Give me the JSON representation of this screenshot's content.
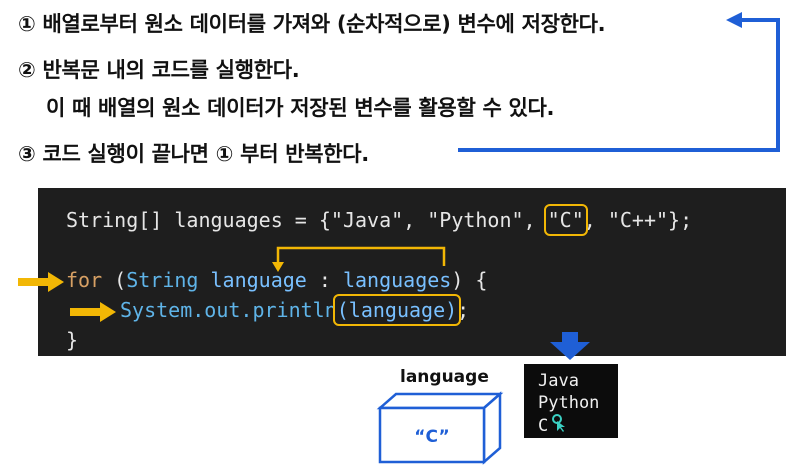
{
  "steps": {
    "s1": "① 배열로부터 원소 데이터를 가져와 (순차적으로) 변수에 저장한다.",
    "s2": "② 반복문 내의 코드를 실행한다.",
    "s2b": "이 때 배열의 원소 데이터가 저장된 변수를 활용할 수 있다.",
    "s3": "③ 코드 실행이 끝나면 ① 부터 반복한다."
  },
  "code": {
    "l1_a": "String[] languages = {\"Java\", \"Python\", ",
    "l1_box": "\"C\"",
    "l1_b": ", \"C++\"};",
    "l2_for": "for",
    "l2_open": " (",
    "l2_type": "String",
    "l2_sp": " ",
    "l2_var": "language",
    "l2_colon": " : ",
    "l2_arr": "languages",
    "l2_close": ") {",
    "l3_fn": "System.out.println",
    "l3_arg": "(language)",
    "l3_end": ";",
    "l4": "}"
  },
  "variable_box": {
    "label": "language",
    "value": "“C”"
  },
  "console": {
    "lines": [
      "Java",
      "Python",
      "C"
    ]
  },
  "colors": {
    "accent_arrow": "#f2b705",
    "loop_arrow": "#1f5fd6"
  }
}
